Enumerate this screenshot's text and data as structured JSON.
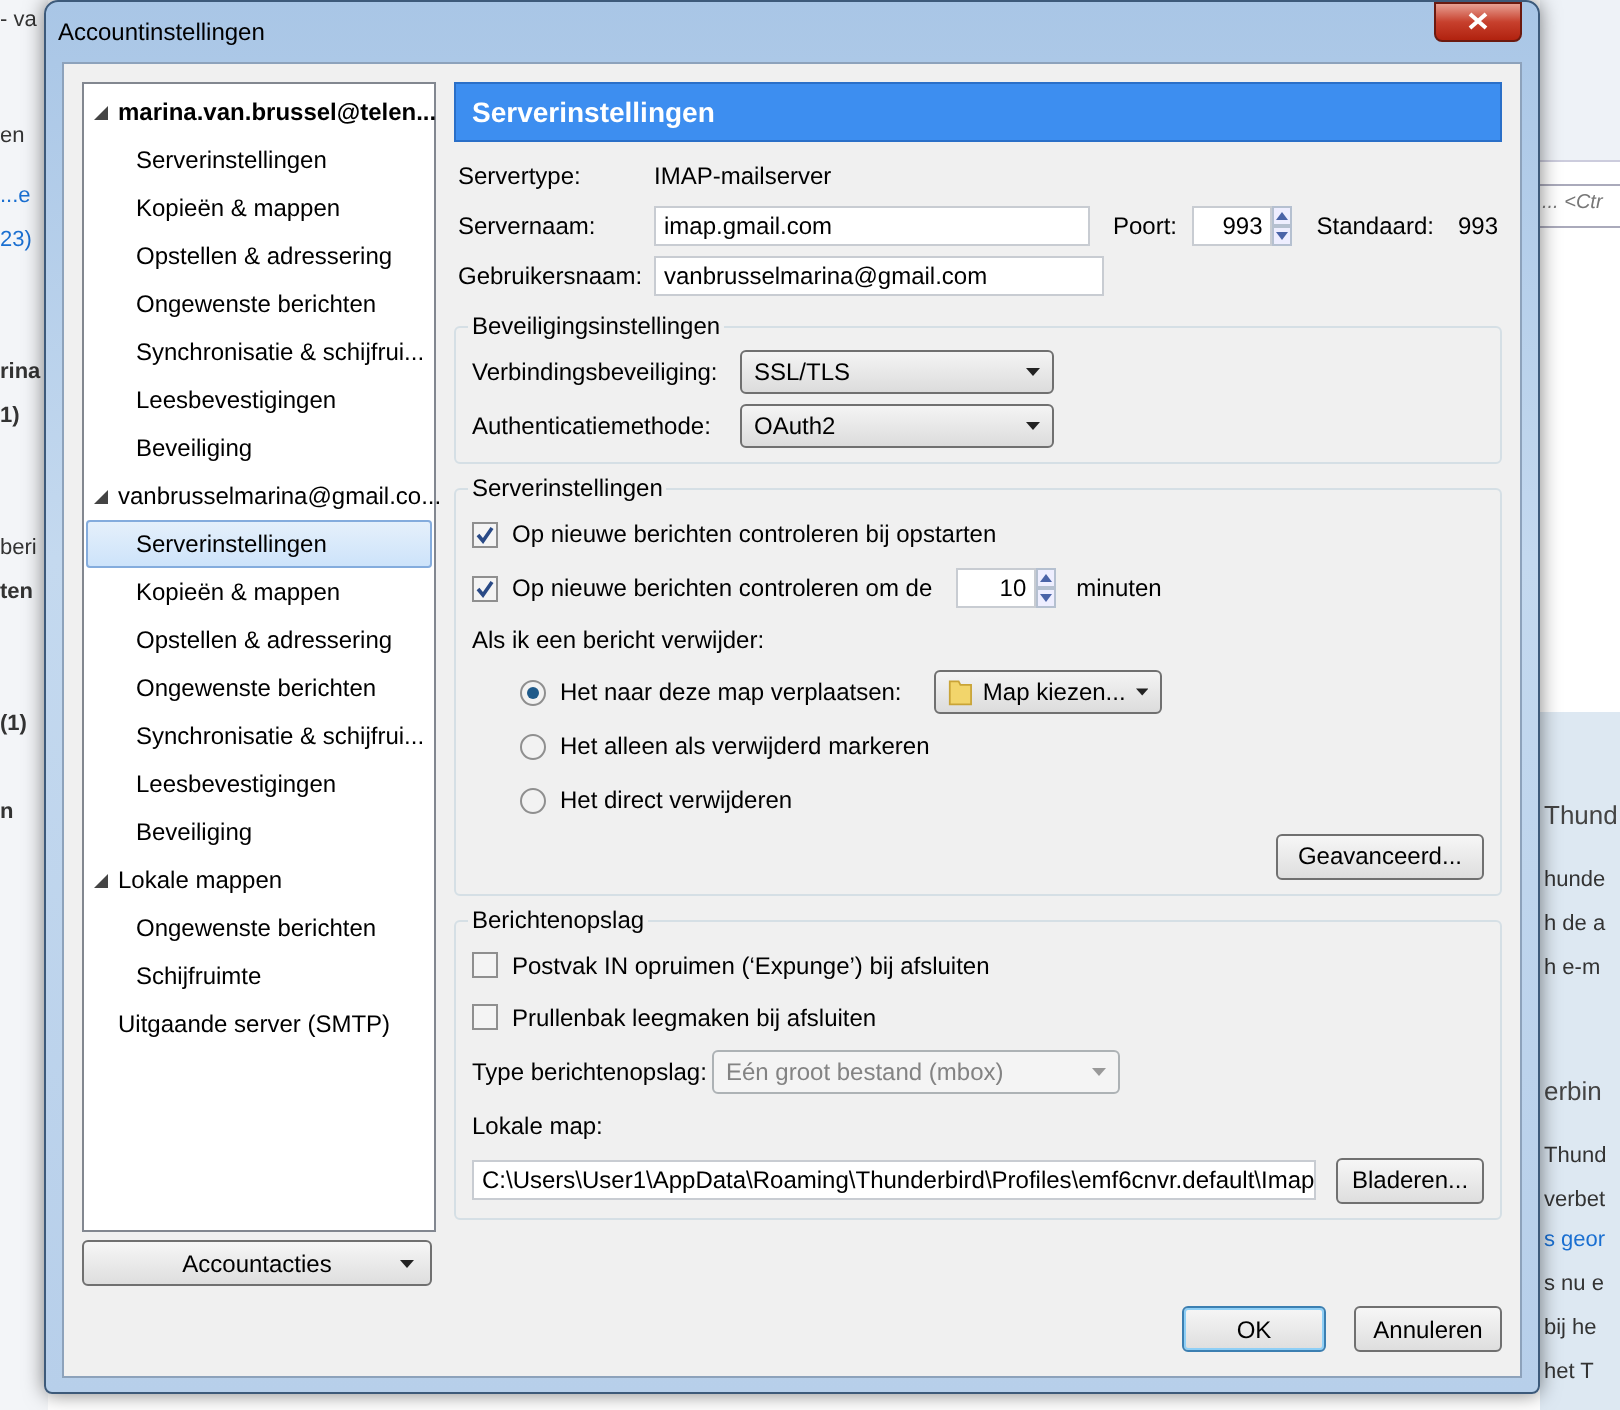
{
  "background": {
    "left_fragments": [
      {
        "text": "- va",
        "kind": "title"
      },
      {
        "text": "en",
        "kind": "text"
      },
      {
        "text": "...e",
        "kind": "link"
      },
      {
        "text": "23)",
        "kind": "link"
      },
      {
        "text": "rina",
        "kind": "bold"
      },
      {
        "text": "1)",
        "kind": "bold"
      },
      {
        "text": "beri",
        "kind": "text"
      },
      {
        "text": "ten",
        "kind": "bold"
      },
      {
        "text": "(1)",
        "kind": "bold"
      },
      {
        "text": "n",
        "kind": "bold"
      }
    ],
    "search_hint": "... <Ctr",
    "right_fragments": [
      {
        "text": "Thund",
        "kind": "heading"
      },
      {
        "text": "hunde",
        "kind": "text"
      },
      {
        "text": "h de a",
        "kind": "text"
      },
      {
        "text": "h e-m",
        "kind": "text"
      },
      {
        "text": "erbin",
        "kind": "heading"
      },
      {
        "text": "Thund",
        "kind": "text"
      },
      {
        "text": "verbet",
        "kind": "text"
      },
      {
        "text": "s geor",
        "kind": "link"
      },
      {
        "text": "s nu e",
        "kind": "text"
      },
      {
        "text": "bij he",
        "kind": "text"
      },
      {
        "text": "het T",
        "kind": "text"
      }
    ]
  },
  "window": {
    "title": "Accountinstellingen"
  },
  "tree": [
    {
      "label": "marina.van.brussel@telen...",
      "bold": true,
      "expanded": true,
      "selected": false,
      "children": [
        {
          "label": "Serverinstellingen",
          "selected": false
        },
        {
          "label": "Kopieën & mappen",
          "selected": false
        },
        {
          "label": "Opstellen & adressering",
          "selected": false
        },
        {
          "label": "Ongewenste berichten",
          "selected": false
        },
        {
          "label": "Synchronisatie & schijfrui...",
          "selected": false
        },
        {
          "label": "Leesbevestigingen",
          "selected": false
        },
        {
          "label": "Beveiliging",
          "selected": false
        }
      ]
    },
    {
      "label": "vanbrusselmarina@gmail.co...",
      "bold": false,
      "expanded": true,
      "selected": false,
      "children": [
        {
          "label": "Serverinstellingen",
          "selected": true
        },
        {
          "label": "Kopieën & mappen",
          "selected": false
        },
        {
          "label": "Opstellen & adressering",
          "selected": false
        },
        {
          "label": "Ongewenste berichten",
          "selected": false
        },
        {
          "label": "Synchronisatie & schijfrui...",
          "selected": false
        },
        {
          "label": "Leesbevestigingen",
          "selected": false
        },
        {
          "label": "Beveiliging",
          "selected": false
        }
      ]
    },
    {
      "label": "Lokale mappen",
      "bold": false,
      "expanded": true,
      "selected": false,
      "children": [
        {
          "label": "Ongewenste berichten",
          "selected": false
        },
        {
          "label": "Schijfruimte",
          "selected": false
        }
      ]
    },
    {
      "label": "Uitgaande server (SMTP)",
      "bold": false,
      "expanded": false,
      "selected": false
    }
  ],
  "account_actions": "Accountacties",
  "panel": {
    "title": "Serverinstellingen",
    "server_type_label": "Servertype:",
    "server_type": "IMAP-mailserver",
    "server_name_label": "Servernaam:",
    "server_name": "imap.gmail.com",
    "port_label": "Poort:",
    "port": "993",
    "default_label": "Standaard:",
    "default_port": "993",
    "user_label": "Gebruikersnaam:",
    "user": "vanbrusselmarina@gmail.com"
  },
  "security": {
    "title": "Beveiligingsinstellingen",
    "rows": [
      {
        "label": "Verbindingsbeveiliging:",
        "value": "SSL/TLS"
      },
      {
        "label": "Authenticatiemethode:",
        "value": "OAuth2"
      }
    ]
  },
  "server_group": {
    "title": "Serverinstellingen",
    "checks": [
      {
        "kind": "plain",
        "label": "Op nieuwe berichten controleren bij opstarten",
        "checked": true
      },
      {
        "kind": "interval",
        "label": "Op nieuwe berichten controleren om de",
        "checked": true,
        "value": "10",
        "unit": "minuten"
      }
    ],
    "delete_label": "Als ik een bericht verwijder:",
    "radios": [
      {
        "label": "Het naar deze map verplaatsen:",
        "selected": true
      },
      {
        "label": "Het alleen als verwijderd markeren",
        "selected": false
      },
      {
        "label": "Het direct verwijderen",
        "selected": false
      }
    ],
    "folder_picker": "Map kiezen...",
    "advanced": "Geavanceerd..."
  },
  "storage": {
    "title": "Berichtenopslag",
    "checks": [
      {
        "label": "Postvak IN opruimen (‘Expunge’) bij afsluiten",
        "checked": false
      },
      {
        "label": "Prullenbak leegmaken bij afsluiten",
        "checked": false
      }
    ],
    "type_label": "Type berichtenopslag:",
    "type_value": "Eén groot bestand (mbox)",
    "type_disabled": true,
    "local_label": "Lokale map:",
    "local_path": "C:\\Users\\User1\\AppData\\Roaming\\Thunderbird\\Profiles\\emf6cnvr.default\\Imap",
    "browse": "Bladeren..."
  },
  "buttons": {
    "ok": "OK",
    "cancel": "Annuleren"
  }
}
